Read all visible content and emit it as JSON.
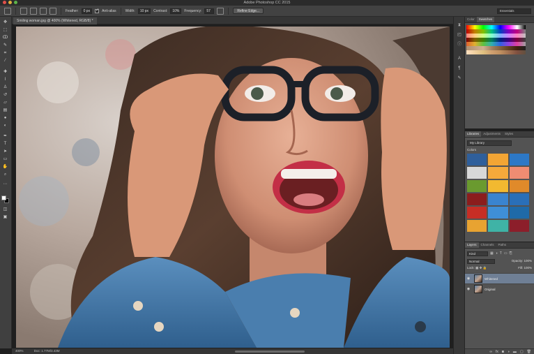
{
  "window": {
    "title": "Adobe Photoshop CC 2015"
  },
  "options_bar": {
    "feather_label": "Feather:",
    "feather_value": "0 px",
    "antialias_label": "Anti-alias",
    "width_label": "Width:",
    "width_value": "10 px",
    "contrast_label": "Contrast:",
    "contrast_value": "10%",
    "frequency_label": "Frequency:",
    "frequency_value": "57",
    "refine_edge_label": "Refine Edge...",
    "workspace_value": "Essentials"
  },
  "document": {
    "tab_label": "Smiling woman.jpg @ 400% (Whitened, RGB/8) *"
  },
  "status_bar": {
    "zoom": "400%",
    "doc_info": "Doc: 1.77M/3.43M"
  },
  "panels": {
    "color": {
      "tabs": [
        "Color",
        "Swatches"
      ]
    },
    "libraries": {
      "tabs": [
        "Libraries",
        "Adjustments",
        "Styles"
      ],
      "library_name": "My Library",
      "colors_label": "Colors",
      "colors": [
        "#2f5f9b",
        "#f3a534",
        "#2d78c6",
        "#d8d8d8",
        "#f5a93b",
        "#ef8c72",
        "#6a9a2f",
        "#f2b930",
        "#e08a2a",
        "#8b1d1d",
        "#3a84cf",
        "#2a6fb8",
        "#c62e25",
        "#3f8fd6",
        "#1f6aa8",
        "#e8a331",
        "#3fb3a6",
        "#8c1e2a"
      ]
    },
    "layers": {
      "tabs": [
        "Layers",
        "Channels",
        "Paths"
      ],
      "kind_label": "Kind",
      "blend_mode": "Normal",
      "opacity_label": "Opacity:",
      "opacity_value": "100%",
      "lock_label": "Lock:",
      "fill_label": "Fill:",
      "fill_value": "100%",
      "items": [
        {
          "name": "Whitened",
          "selected": true
        },
        {
          "name": "Original",
          "selected": false
        }
      ]
    }
  }
}
